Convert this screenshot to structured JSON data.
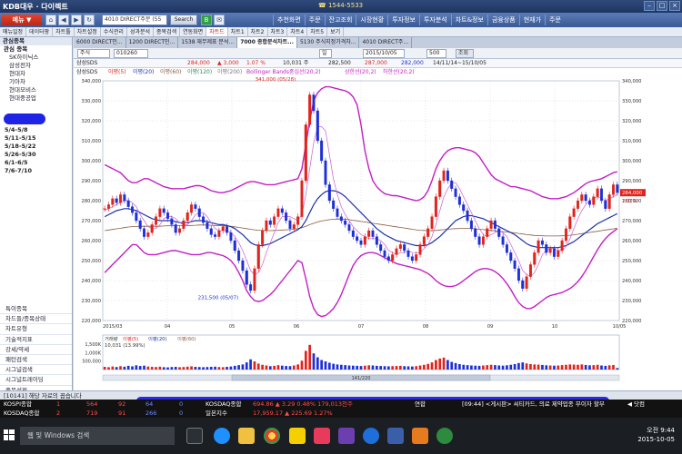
{
  "window": {
    "brand": "KDB대우 · 다이렉트",
    "phone": "☎ 1544-5533",
    "controls": [
      "–",
      "□",
      "×"
    ]
  },
  "toolbar": {
    "menu_label": "메뉴 ▼",
    "screen_input": "4010 DIRECT주문 (55",
    "search_label": "Search",
    "top_menu": [
      "추천화면",
      "주문",
      "잔고조회",
      "시장현황",
      "투자정보",
      "투자분석",
      "차트&정보",
      "금융상품",
      "현재가",
      "주문"
    ]
  },
  "subtabs": [
    "메뉴일정",
    "데이터팡",
    "차트툴",
    "차트설정",
    "수식관리",
    "성과분석",
    "종목검색",
    "연동화면",
    "차트드",
    "차트1",
    "차트2",
    "차트3",
    "차트4",
    "차트5",
    "보기"
  ],
  "window_tabs": [
    "6000 DIRECT인...",
    "1200 DIRECT인...",
    "1538 재무제표 분석...",
    "7000 종합분석차트...",
    "5130 주식지정가격차...",
    "4010 DIRECT주..."
  ],
  "active_tab_index": 3,
  "sidebar": {
    "header": "관심종목",
    "group": "관심 종목",
    "stocks": [
      "SK하이닉스",
      "삼성전자",
      "현대차",
      "기아차",
      "현대모비스",
      "현대중공업"
    ],
    "tree": [
      "5/4-5/8",
      "5/11-5/15",
      "5/18-5/22",
      "5/26-5/30",
      "6/1-6/5",
      "7/6-7/10"
    ],
    "bottom_menu": [
      "특이종목",
      "차드들/종목상태",
      "차트유형",
      "기술적지표",
      "강세/약세",
      "패턴검색",
      "시그널검색",
      "시그널트레이딩",
      "종목설정"
    ]
  },
  "controls": {
    "market": "주식",
    "code": "010260",
    "interval": "일",
    "date": "2015/10/05",
    "count": "500",
    "query": "조회"
  },
  "quote": {
    "name": "삼성SDS",
    "price": "284,000",
    "change": "▲ 3,000",
    "change_pct": "1.07 %",
    "volume": "10,031 주",
    "open": "282,500",
    "high": "287,000",
    "low": "282,000",
    "range": "14/11/14~15/10/05"
  },
  "legend": {
    "stock": "삼성SDS",
    "ma5": "이평(5)",
    "ma20": "이평(20)",
    "ma60": "이평(60)",
    "ma120": "이평(120)",
    "ma200": "이평(200)",
    "bb": "Bollinger Bands중심선(20,2)",
    "upper": "상한선(20,2)",
    "lower": "하한선(20,2)"
  },
  "annotations": {
    "high": "341,000 (05/28)",
    "low": "231,500 (05/07)",
    "last_price": "284,000",
    "last_pct": "1.07%"
  },
  "volume_panel": {
    "legend": [
      "거래량",
      "이평(5)",
      "이평(20)",
      "이평(60)"
    ],
    "last": "10,031 (13.99%)",
    "scroll_label": "141/220"
  },
  "status_message": "[10141] 해당 자료의 꼽습니다",
  "ticker": {
    "rows": [
      {
        "name": "KOSPI종합",
        "v1": "1",
        "v2": "564",
        "v3": "92",
        "v4": "64",
        "v5": "0"
      },
      {
        "name": "KOSDAQ종합",
        "v1": "2",
        "v2": "719",
        "v3": "91",
        "v4": "266",
        "v5": "0"
      }
    ],
    "mid1_name": "KOSDAQ종합",
    "mid1_val": "694.86 ▲ 3.29 0.48% 179,013천주",
    "mid2_name": "일본지수",
    "mid2_val": "17,959.17 ▲ 225.69 1.27%",
    "news_label": "연합",
    "news": "[09:44] <게시판> 씨티카드, 의료 제약업종 무이자 할부",
    "news_tag": "◀ 닷컴"
  },
  "taskbar": {
    "search_placeholder": "웹 및 Windows 검색",
    "time": "오전 9:44",
    "date": "2015-10-05"
  },
  "colors": {
    "up": "#e0231c",
    "down": "#1e2fd6",
    "ma_blue": "#1e32a8",
    "bb_purple": "#c41ec4",
    "ma_brown": "#8b5a3c"
  },
  "chart_data": {
    "type": "candlestick",
    "y_min": 220000,
    "y_max": 340000,
    "y_ticks": [
      "340,000",
      "330,000",
      "320,000",
      "310,000",
      "300,000",
      "290,000",
      "280,000",
      "270,000",
      "260,000",
      "250,000",
      "240,000",
      "230,000",
      "220,000"
    ],
    "volume_ticks": [
      "1,500K",
      "1,000K",
      "500,000"
    ],
    "x_labels": [
      "2015/03",
      "04",
      "05",
      "06",
      "07",
      "08",
      "09",
      "10",
      "10/05"
    ],
    "close": [
      276000,
      278000,
      281000,
      279000,
      283000,
      280000,
      277000,
      274000,
      270000,
      266000,
      262000,
      264000,
      268000,
      272000,
      276000,
      274000,
      271000,
      268000,
      264000,
      266000,
      270000,
      274000,
      278000,
      276000,
      272000,
      269000,
      266000,
      263000,
      262000,
      265000,
      267000,
      264000,
      260000,
      255000,
      250000,
      245000,
      238000,
      235000,
      246000,
      258000,
      265000,
      270000,
      268000,
      272000,
      276000,
      274000,
      270000,
      266000,
      268000,
      272000,
      290000,
      318000,
      333000,
      325000,
      310000,
      300000,
      288000,
      280000,
      276000,
      272000,
      270000,
      268000,
      265000,
      262000,
      260000,
      258000,
      262000,
      265000,
      262000,
      258000,
      255000,
      252000,
      250000,
      253000,
      256000,
      258000,
      255000,
      252000,
      250000,
      253000,
      258000,
      262000,
      266000,
      272000,
      282000,
      290000,
      295000,
      290000,
      286000,
      282000,
      278000,
      275000,
      270000,
      266000,
      262000,
      258000,
      262000,
      266000,
      270000,
      266000,
      262000,
      258000,
      254000,
      250000,
      246000,
      240000,
      236000,
      242000,
      248000,
      254000,
      260000,
      258000,
      254000,
      256000,
      252000,
      255000,
      260000,
      266000,
      272000,
      276000,
      280000,
      283000,
      280000,
      278000,
      282000,
      286000,
      280000,
      276000,
      283000,
      288000,
      284000
    ],
    "volume": [
      160000,
      140000,
      180000,
      150000,
      200000,
      170000,
      220000,
      190000,
      250000,
      210000,
      230000,
      180000,
      160000,
      150000,
      170000,
      140000,
      130000,
      150000,
      160000,
      140000,
      150000,
      170000,
      190000,
      160000,
      150000,
      140000,
      150000,
      160000,
      170000,
      150000,
      140000,
      160000,
      180000,
      220000,
      260000,
      300000,
      420000,
      600000,
      480000,
      350000,
      280000,
      240000,
      200000,
      220000,
      260000,
      230000,
      210000,
      200000,
      240000,
      300000,
      520000,
      1100000,
      1450000,
      950000,
      720000,
      560000,
      480000,
      400000,
      340000,
      300000,
      280000,
      260000,
      240000,
      230000,
      220000,
      210000,
      230000,
      250000,
      240000,
      220000,
      210000,
      200000,
      190000,
      200000,
      210000,
      220000,
      200000,
      190000,
      180000,
      200000,
      240000,
      280000,
      330000,
      420000,
      560000,
      650000,
      700000,
      560000,
      450000,
      380000,
      320000,
      280000,
      260000,
      240000,
      230000,
      220000,
      240000,
      260000,
      280000,
      260000,
      240000,
      230000,
      250000,
      280000,
      320000,
      380000,
      420000,
      360000,
      320000,
      300000,
      290000,
      270000,
      250000,
      240000,
      230000,
      240000,
      260000,
      280000,
      300000,
      290000,
      280000,
      300000,
      270000,
      250000,
      260000,
      280000,
      240000,
      220000,
      250000,
      270000,
      90000
    ],
    "ma5": [
      275000,
      276000,
      277000,
      278000,
      279000,
      280000,
      280000,
      279000,
      277000,
      273000,
      270000,
      267000,
      266000,
      266000,
      268000,
      271000,
      272000,
      272000,
      271000,
      269000,
      268000,
      268000,
      270000,
      273000,
      274000,
      274000,
      272000,
      269000,
      266000,
      265000,
      265000,
      265000,
      264000,
      262000,
      259000,
      255000,
      250000,
      245000,
      243000,
      244000,
      248000,
      254000,
      259000,
      264000,
      269000,
      272000,
      272000,
      272000,
      271000,
      270000,
      273000,
      283000,
      296000,
      309000,
      317000,
      317000,
      315000,
      303000,
      291000,
      283000,
      277000,
      273000,
      270000,
      267000,
      265000,
      263000,
      262000,
      261000,
      261000,
      261000,
      260000,
      258000,
      255000,
      254000,
      253000,
      254000,
      254000,
      255000,
      254000,
      254000,
      254000,
      256000,
      258000,
      262000,
      268000,
      275000,
      282000,
      286000,
      289000,
      289000,
      286000,
      282000,
      278000,
      274000,
      270000,
      266000,
      263000,
      262000,
      263000,
      264000,
      265000,
      264000,
      262000,
      258000,
      254000,
      250000,
      245000,
      243000,
      242000,
      244000,
      248000,
      253000,
      255000,
      256000,
      256000,
      255000,
      255000,
      257000,
      261000,
      266000,
      271000,
      275000,
      278000,
      280000,
      281000,
      282000,
      281000,
      280000,
      281000,
      282000,
      283000
    ],
    "ma20": [
      272000,
      273000,
      274000,
      275000,
      275500,
      276000,
      276000,
      275500,
      275000,
      274000,
      273000,
      272000,
      271000,
      270500,
      270000,
      270000,
      270000,
      270000,
      269500,
      269000,
      269000,
      269000,
      269500,
      270000,
      270000,
      270000,
      269500,
      269000,
      268500,
      268000,
      268000,
      267500,
      267000,
      266000,
      264500,
      263000,
      261000,
      259000,
      258000,
      257500,
      257500,
      258000,
      258500,
      259500,
      260500,
      261500,
      262500,
      263500,
      264500,
      265500,
      267000,
      270000,
      274000,
      278000,
      281000,
      283000,
      284500,
      285000,
      285000,
      284500,
      283500,
      282000,
      280000,
      278000,
      276000,
      274000,
      272000,
      270000,
      268000,
      266000,
      264500,
      263000,
      262000,
      261000,
      260000,
      259500,
      259000,
      258500,
      258000,
      257500,
      257500,
      257500,
      258000,
      259000,
      260500,
      262000,
      264000,
      266000,
      268000,
      270000,
      271000,
      272000,
      272500,
      272500,
      272000,
      271500,
      271000,
      270000,
      269000,
      268000,
      267000,
      266000,
      265000,
      264000,
      263000,
      261500,
      260000,
      258500,
      257500,
      257000,
      256500,
      256500,
      256500,
      256500,
      256500,
      256500,
      257000,
      257500,
      258500,
      259500,
      261000,
      262500,
      264000,
      265500,
      267000,
      268500,
      269500,
      270500,
      271500,
      272500,
      273500
    ],
    "ma60": [
      265000,
      265300,
      265600,
      265900,
      266200,
      266500,
      266800,
      267000,
      267100,
      267200,
      267200,
      267200,
      267200,
      267200,
      267200,
      267300,
      267400,
      267500,
      267500,
      267500,
      267500,
      267500,
      267600,
      267700,
      267800,
      267800,
      267800,
      267700,
      267600,
      267500,
      267400,
      267300,
      267100,
      266900,
      266600,
      266300,
      266000,
      265700,
      265400,
      265200,
      265100,
      265000,
      265000,
      265100,
      265200,
      265300,
      265400,
      265500,
      265700,
      266000,
      266500,
      267200,
      268000,
      268700,
      269300,
      269800,
      270200,
      270500,
      270700,
      270800,
      270800,
      270700,
      270500,
      270200,
      269900,
      269600,
      269300,
      269000,
      268700,
      268400,
      268100,
      267800,
      267500,
      267200,
      266900,
      266600,
      266300,
      266000,
      265700,
      265400,
      265200,
      265100,
      265000,
      265000,
      265100,
      265300,
      265500,
      265700,
      265900,
      266000,
      266100,
      266100,
      266100,
      266000,
      265900,
      265700,
      265500,
      265300,
      265100,
      264900,
      264700,
      264500,
      264300,
      264100,
      263900,
      263600,
      263300,
      263000,
      262800,
      262600,
      262500,
      262400,
      262300,
      262300,
      262300,
      262300,
      262400,
      262500,
      262700,
      262900,
      263200,
      263500,
      263800,
      264100,
      264400,
      264700,
      265000,
      265300,
      265600,
      265900,
      266200
    ],
    "bb_upper": [
      298000,
      297000,
      296000,
      295000,
      294000,
      292000,
      290000,
      289000,
      289000,
      290000,
      291000,
      291000,
      290000,
      289000,
      288000,
      287000,
      286500,
      286000,
      286000,
      286000,
      286000,
      286500,
      287000,
      287500,
      287500,
      287000,
      286000,
      285000,
      284500,
      284000,
      284000,
      284500,
      285000,
      286000,
      287000,
      288000,
      289000,
      289500,
      289500,
      289000,
      288500,
      288000,
      288000,
      288000,
      288500,
      289000,
      289500,
      290000,
      290500,
      291000,
      296000,
      308000,
      320000,
      330000,
      334000,
      336000,
      337000,
      337000,
      336500,
      336000,
      335500,
      335000,
      334000,
      332000,
      328000,
      318000,
      305000,
      296000,
      290000,
      287000,
      285000,
      283500,
      283000,
      282500,
      282500,
      282000,
      281500,
      281000,
      280500,
      280000,
      280500,
      282000,
      285000,
      290000,
      296000,
      300000,
      303000,
      305000,
      306000,
      306500,
      306500,
      306000,
      305500,
      305000,
      304000,
      302000,
      299000,
      296000,
      293000,
      291000,
      290000,
      289000,
      288000,
      287000,
      287000,
      286500,
      286000,
      285500,
      285000,
      284000,
      283000,
      282000,
      281500,
      281000,
      281000,
      281000,
      281500,
      282000,
      283000,
      284000,
      285500,
      287000,
      288500,
      289500,
      290000,
      290500,
      291000,
      292000,
      293000,
      294000,
      294500
    ],
    "bb_lower": [
      244000,
      246000,
      248000,
      250000,
      252000,
      254000,
      256000,
      258000,
      258000,
      256000,
      254000,
      253000,
      253000,
      253000,
      253500,
      254000,
      254500,
      255000,
      255000,
      254500,
      254000,
      253500,
      253000,
      253000,
      253000,
      253500,
      254000,
      254000,
      253500,
      253000,
      252500,
      251500,
      250000,
      247500,
      244000,
      240000,
      235000,
      232000,
      230000,
      229500,
      230000,
      231500,
      233000,
      235000,
      237500,
      240000,
      242500,
      245000,
      247500,
      250000,
      249000,
      241000,
      232000,
      226000,
      223000,
      222000,
      222500,
      224000,
      226000,
      229000,
      233000,
      238000,
      243000,
      247500,
      250500,
      252500,
      253500,
      254000,
      254000,
      253500,
      252500,
      251500,
      250500,
      249500,
      248500,
      248000,
      247500,
      247000,
      246500,
      246000,
      245500,
      244500,
      243500,
      242000,
      240000,
      238500,
      237500,
      237000,
      237000,
      237500,
      238500,
      240000,
      241500,
      243000,
      244500,
      245500,
      246000,
      246000,
      245500,
      244500,
      243000,
      241000,
      238500,
      235500,
      232000,
      229000,
      227000,
      226000,
      226000,
      227000,
      228500,
      230000,
      231500,
      232500,
      233000,
      233500,
      234000,
      235000,
      236000,
      237500,
      239500,
      242000,
      245000,
      248500,
      252000,
      255500,
      258500,
      261000,
      263000,
      264500,
      266000
    ]
  }
}
